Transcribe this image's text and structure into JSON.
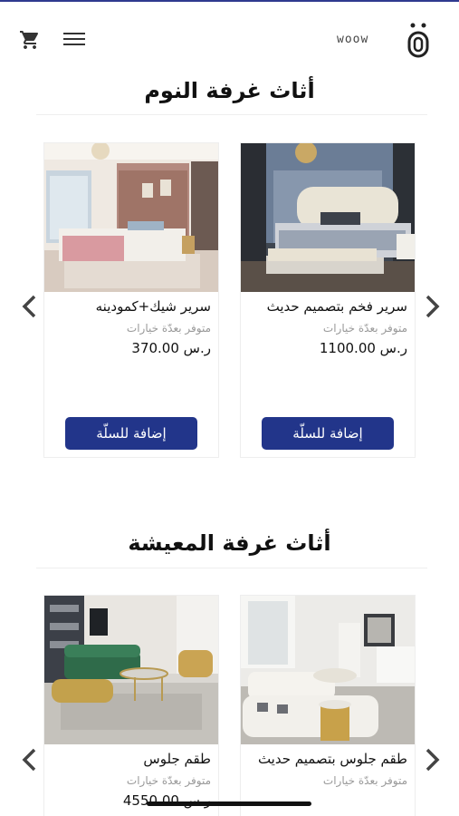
{
  "header": {
    "brand": "woow",
    "cart_icon": "cart-icon",
    "menu_icon": "hamburger-menu-icon",
    "logo": "woow-logo"
  },
  "sections": [
    {
      "title": "أثاث غرفة النوم",
      "products": [
        {
          "name": "سرير فخم بتصميم حديث",
          "options": "متوفر بعدّة خيارات",
          "price": "ر.س 1100.00",
          "button": "إضافة للسلّة"
        },
        {
          "name": "سرير شيك+كمودينه",
          "options": "متوفر بعدّة خيارات",
          "price": "ر.س 370.00",
          "button": "إضافة للسلّة"
        }
      ]
    },
    {
      "title": "أثاث غرفة المعيشة",
      "products": [
        {
          "name": "طقم جلوس بتصميم حديث",
          "options": "متوفر بعدّة خيارات"
        },
        {
          "name": "طقم جلوس",
          "options": "متوفر بعدّة خيارات",
          "price": "ر.س 4550.00"
        }
      ]
    }
  ],
  "colors": {
    "accent": "#22358a",
    "top_line": "#2f3a8f"
  }
}
